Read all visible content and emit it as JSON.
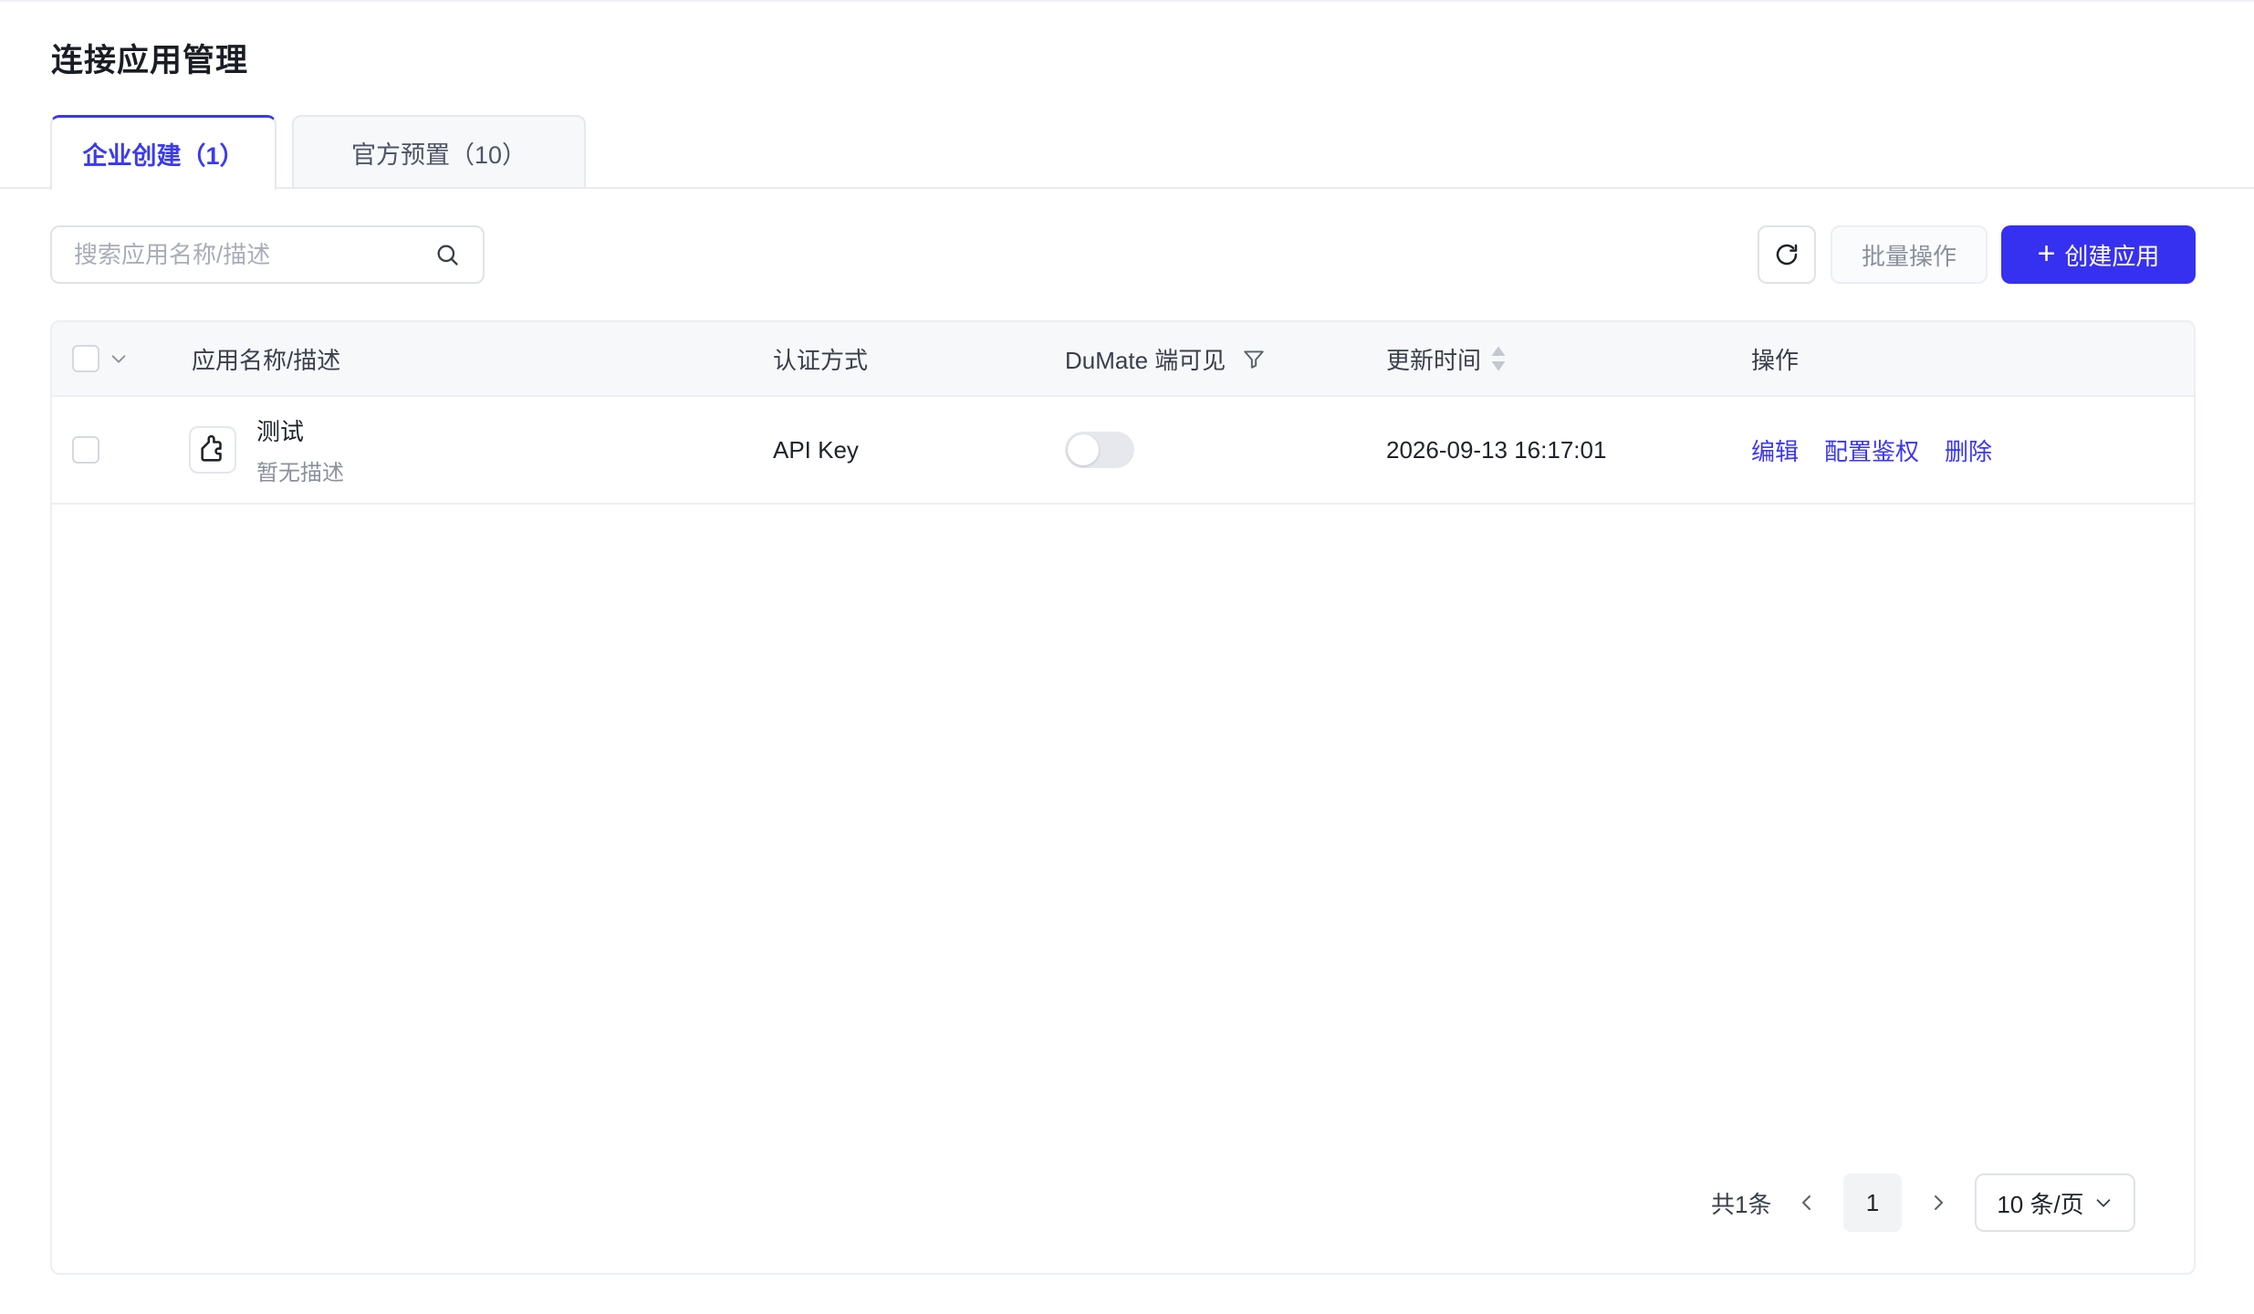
{
  "page": {
    "title": "连接应用管理"
  },
  "tabs": [
    {
      "label": "企业创建（1）",
      "active": true
    },
    {
      "label": "官方预置（10）",
      "active": false
    }
  ],
  "toolbar": {
    "search_placeholder": "搜索应用名称/描述",
    "batch_label": "批量操作",
    "create_label": "创建应用"
  },
  "table": {
    "columns": [
      "应用名称/描述",
      "认证方式",
      "DuMate 端可见",
      "更新时间",
      "操作"
    ],
    "rows": [
      {
        "name": "测试",
        "description": "暂无描述",
        "auth": "API Key",
        "dumate_visible": false,
        "updated": "2026-09-13 16:17:01",
        "actions": [
          "编辑",
          "配置鉴权",
          "删除"
        ]
      }
    ]
  },
  "pagination": {
    "total_label": "共1条",
    "current_page": "1",
    "page_size_label": "10 条/页"
  },
  "colors": {
    "accent": "#3631f0",
    "link": "#3a36f5"
  }
}
